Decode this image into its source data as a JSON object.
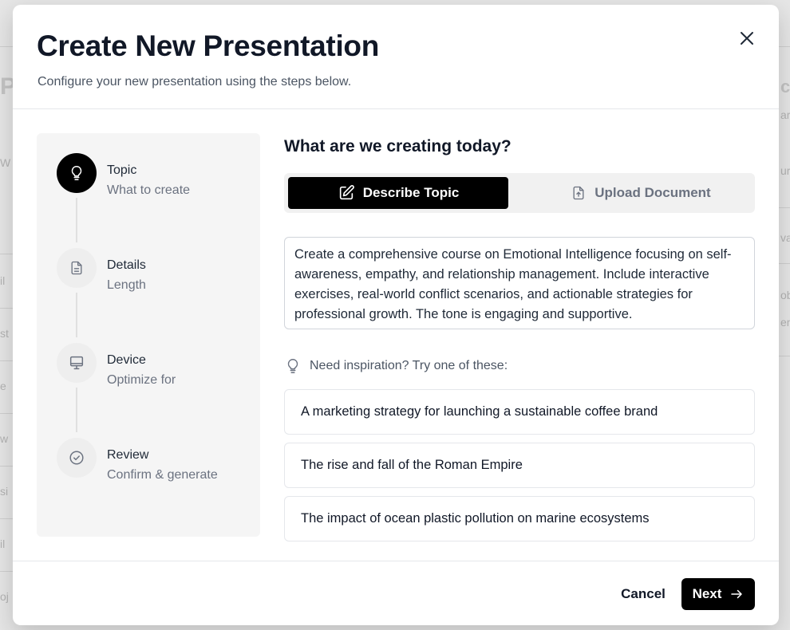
{
  "modal": {
    "title": "Create New Presentation",
    "subtitle": "Configure your new presentation using the steps below."
  },
  "steps": [
    {
      "label": "Topic",
      "sub": "What to create",
      "icon": "lightbulb-icon",
      "state": "active"
    },
    {
      "label": "Details",
      "sub": "Length",
      "icon": "document-icon",
      "state": "pending"
    },
    {
      "label": "Device",
      "sub": "Optimize for",
      "icon": "monitor-icon",
      "state": "pending"
    },
    {
      "label": "Review",
      "sub": "Confirm & generate",
      "icon": "check-circle-icon",
      "state": "pending"
    }
  ],
  "content": {
    "heading": "What are we creating today?",
    "modes": {
      "describe": "Describe Topic",
      "upload": "Upload Document",
      "selected": "describe"
    },
    "topic_text": "Create a comprehensive course on Emotional Intelligence focusing on self-awareness, empathy, and relationship management. Include interactive exercises, real-world conflict scenarios, and actionable strategies for professional growth. The tone is engaging and supportive.",
    "inspiration_label": "Need inspiration? Try one of these:",
    "suggestions": [
      "A marketing strategy for launching a sustainable coffee brand",
      "The rise and fall of the Roman Empire",
      "The impact of ocean plastic pollution on marine ecosystems"
    ]
  },
  "footer": {
    "cancel_label": "Cancel",
    "next_label": "Next"
  },
  "colors": {
    "primary": "#000000",
    "surface": "#ffffff",
    "muted_text": "#6b7280",
    "stepper_bg": "#f5f5f5"
  }
}
